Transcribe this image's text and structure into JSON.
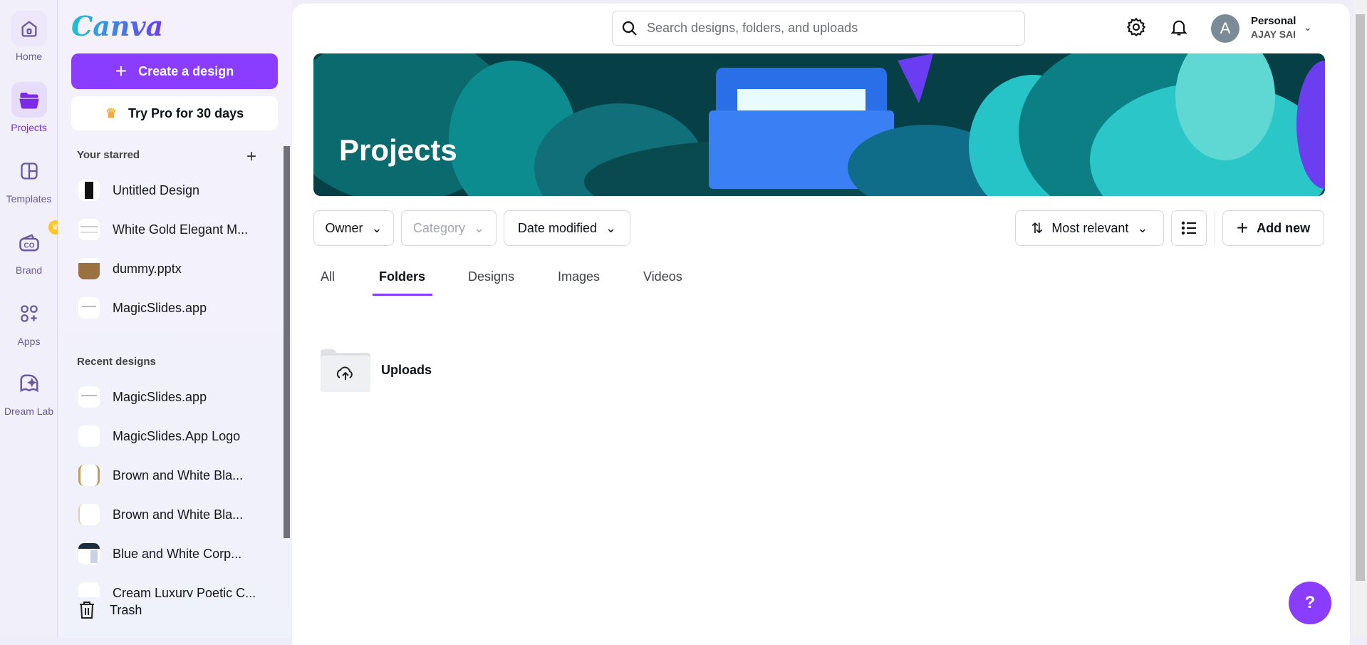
{
  "rail": [
    {
      "label": "Home",
      "icon": "home-icon"
    },
    {
      "label": "Projects",
      "icon": "folder-icon",
      "active": true
    },
    {
      "label": "Templates",
      "icon": "templates-icon"
    },
    {
      "label": "Brand",
      "icon": "brand-icon"
    },
    {
      "label": "Apps",
      "icon": "apps-icon"
    },
    {
      "label": "Dream Lab",
      "icon": "dream-lab-icon"
    }
  ],
  "logo": "Canva",
  "create_label": "Create a design",
  "try_pro_label": "Try Pro for 30 days",
  "starred": {
    "title": "Your starred",
    "items": [
      "Untitled Design",
      "White Gold Elegant M...",
      "dummy.pptx",
      "MagicSlides.app"
    ]
  },
  "recent": {
    "title": "Recent designs",
    "items": [
      "MagicSlides.app",
      "MagicSlides.App Logo",
      "Brown and White Bla...",
      "Brown and White Bla...",
      "Blue and White Corp...",
      "Cream Luxury Poetic C..."
    ]
  },
  "trash_label": "Trash",
  "search": {
    "placeholder": "Search designs, folders, and uploads"
  },
  "account": {
    "initial": "A",
    "type": "Personal",
    "name": "AJAY SAI"
  },
  "banner_title": "Projects",
  "filters": {
    "owner": "Owner",
    "category": "Category",
    "date": "Date modified",
    "sort": "Most relevant",
    "add_new": "Add new"
  },
  "tabs": [
    "All",
    "Folders",
    "Designs",
    "Images",
    "Videos"
  ],
  "active_tab": "Folders",
  "folders": [
    {
      "name": "Uploads"
    }
  ],
  "help_label": "?",
  "colors": {
    "accent": "#8b3dff"
  }
}
